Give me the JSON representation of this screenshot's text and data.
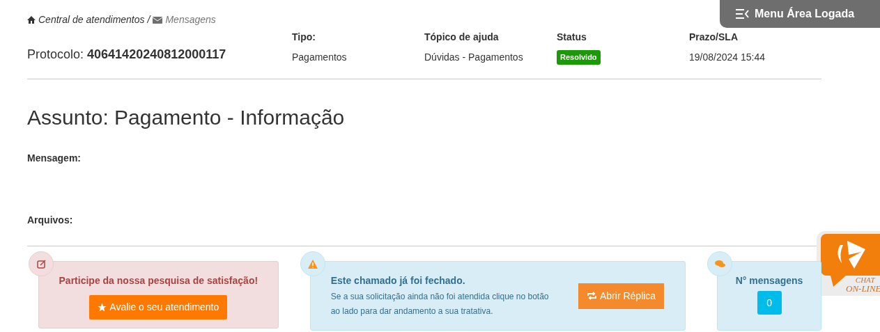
{
  "breadcrumb": [
    {
      "label": "Central de atendimentos",
      "selected": false
    },
    {
      "label": "Mensagens",
      "selected": true
    }
  ],
  "breadcrumb_separator": "/",
  "menu_button": {
    "label": "Menu Área Logada"
  },
  "protocol": {
    "label": "Protocolo:",
    "value": "40641420240812000117"
  },
  "fields": [
    {
      "label": "Tipo:",
      "value": "Pagamentos",
      "kind": "text"
    },
    {
      "label": "Tópico de ajuda",
      "value": "Dúvidas - Pagamentos",
      "kind": "text"
    },
    {
      "label": "Status",
      "value": "Resolvido",
      "kind": "badge",
      "color": "#1a9a06"
    },
    {
      "label": "Prazo/SLA",
      "value": "19/08/2024 15:44",
      "kind": "text"
    }
  ],
  "subject": "Assunto: Pagamento - Informação",
  "message_label": "Mensagem:",
  "files_label": "Arquivos:",
  "survey_card": {
    "title": "Participe da nossa pesquisa de satisfação!",
    "button": "Avalie o seu atendimento"
  },
  "closed_card": {
    "title": "Este chamado já foi fechado.",
    "text": "Se a sua solicitação ainda não foi atendida clique no botão ao lado para dar andamento a sua tratativa.",
    "button": "Abrir Réplica"
  },
  "messages_card": {
    "title": "N° mensagens",
    "count": "0"
  },
  "chat_widget": {
    "line1": "CHAT",
    "line2": "ON-LINE"
  }
}
